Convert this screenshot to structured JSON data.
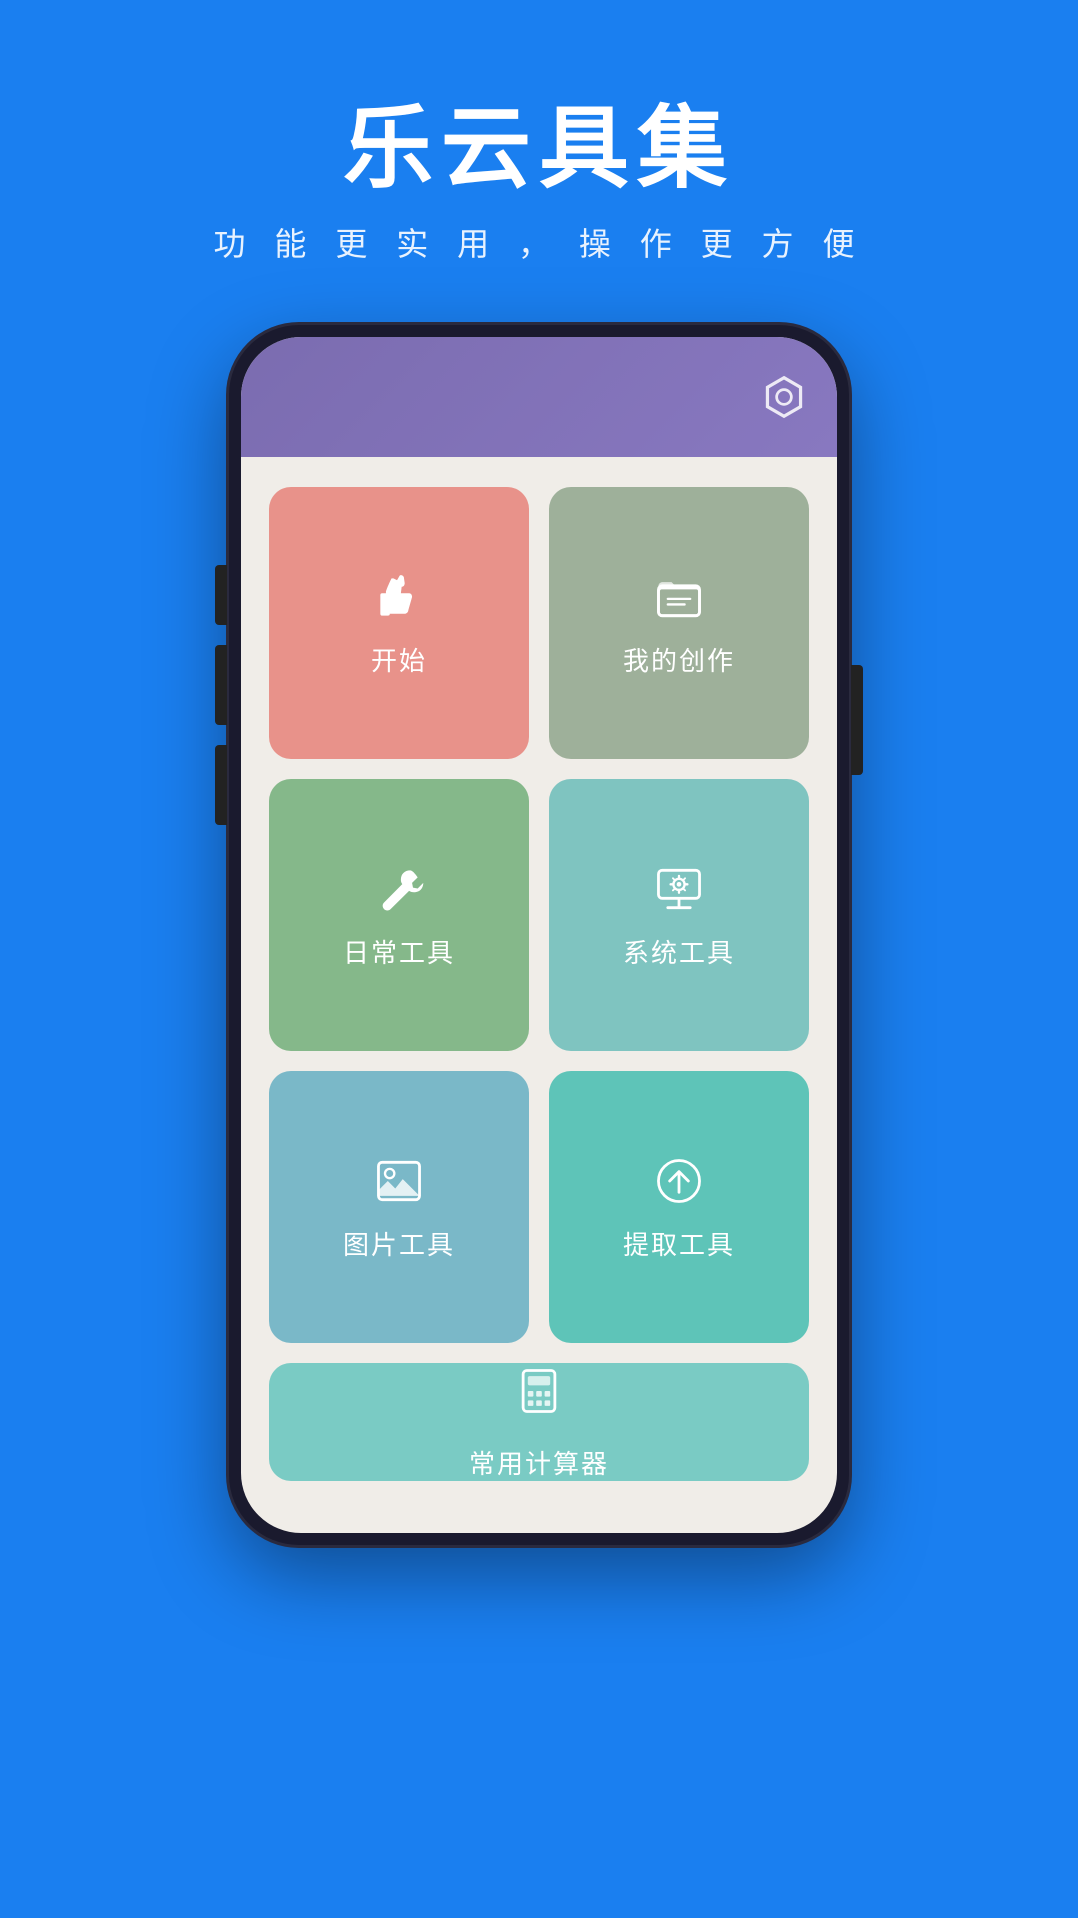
{
  "header": {
    "title": "乐云具集",
    "subtitle": "功 能 更 实 用 ， 操 作 更 方 便"
  },
  "phone": {
    "header_icon": "settings-hex",
    "cells": [
      {
        "id": "start",
        "label": "开始",
        "icon": "thumb-up",
        "color": "#e8928a"
      },
      {
        "id": "mywork",
        "label": "我的创作",
        "icon": "folder-doc",
        "color": "#9eb09a"
      },
      {
        "id": "daily",
        "label": "日常工具",
        "icon": "wrench",
        "color": "#85b88a"
      },
      {
        "id": "system",
        "label": "系统工具",
        "icon": "monitor-gear",
        "color": "#7fc4c0"
      },
      {
        "id": "image",
        "label": "图片工具",
        "icon": "image-frame",
        "color": "#7ab8c8"
      },
      {
        "id": "extract",
        "label": "提取工具",
        "icon": "upload-circle",
        "color": "#5ec4b8"
      },
      {
        "id": "calc",
        "label": "常用计算器",
        "icon": "calculator",
        "color": "#7acbc4"
      }
    ]
  },
  "colors": {
    "bg": "#1a7ff0",
    "phone_frame": "#1a1a2e",
    "phone_header": "#8878c0"
  }
}
